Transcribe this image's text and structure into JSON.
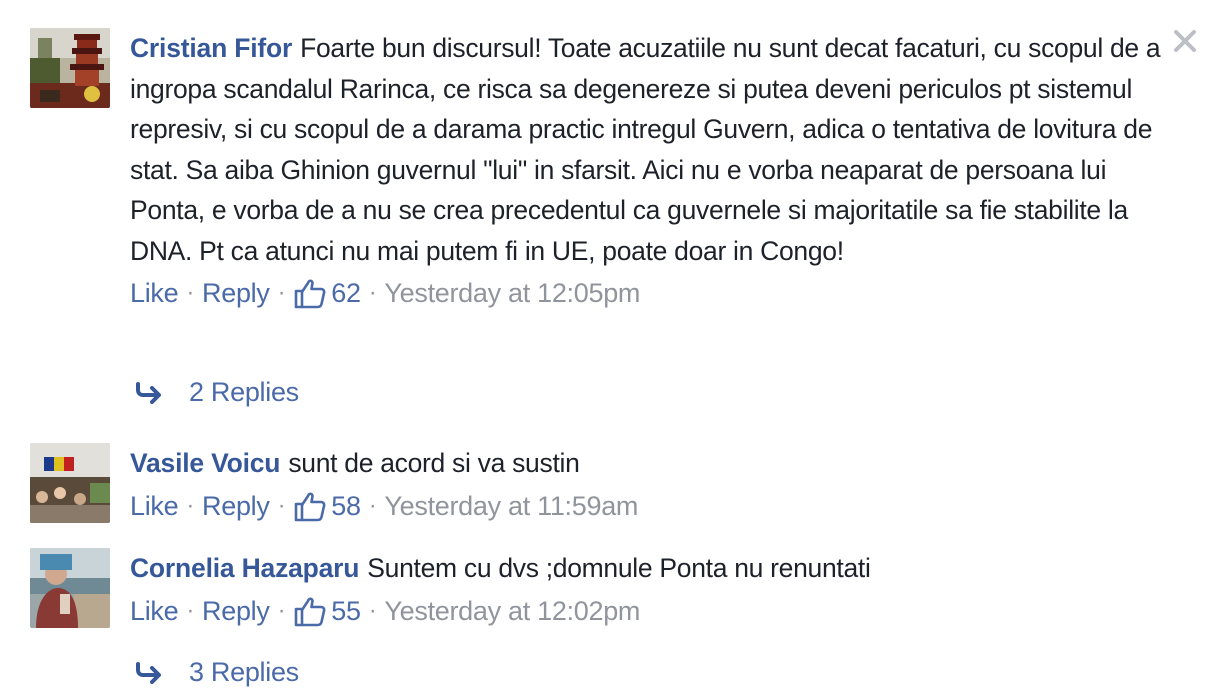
{
  "comments": [
    {
      "author": "Cristian Fifor",
      "text": "Foarte bun discursul! Toate acuzatiile nu sunt decat facaturi, cu scopul de a ingropa scandalul Rarinca, ce risca sa degenereze si putea deveni periculos pt sistemul represiv, si cu scopul de a darama practic intregul Guvern, adica o tentativa de lovitura de stat. Sa aiba Ghinion guvernul \"lui\" in sfarsit. Aici nu e vorba neaparat de persoana lui Ponta, e vorba de a nu se crea precedentul ca guvernele si majoritatile sa fie stabilite la DNA. Pt ca atunci nu mai putem fi in UE, poate doar in Congo!",
      "like_label": "Like",
      "reply_label": "Reply",
      "like_count": "62",
      "timestamp": "Yesterday at 12:05pm",
      "replies_label": "2 Replies",
      "avatar_icon": "pagoda-photo-avatar"
    },
    {
      "author": "Vasile Voicu",
      "text": "sunt de acord si va sustin",
      "like_label": "Like",
      "reply_label": "Reply",
      "like_count": "58",
      "timestamp": "Yesterday at 11:59am",
      "avatar_icon": "crowd-flag-photo-avatar"
    },
    {
      "author": "Cornelia Hazaparu",
      "text": "Suntem cu dvs ;domnule Ponta nu renuntati",
      "like_label": "Like",
      "reply_label": "Reply",
      "like_count": "55",
      "timestamp": "Yesterday at 12:02pm",
      "replies_label": "3 Replies",
      "avatar_icon": "seaside-portrait-photo-avatar"
    }
  ],
  "icons": {
    "close": "close-icon",
    "like": "thumbs-up-icon",
    "reply_arrow": "reply-arrow-icon"
  },
  "colors": {
    "author": "#365899",
    "link": "#4b6aa8",
    "text": "#1d2129",
    "muted": "#90949c"
  }
}
